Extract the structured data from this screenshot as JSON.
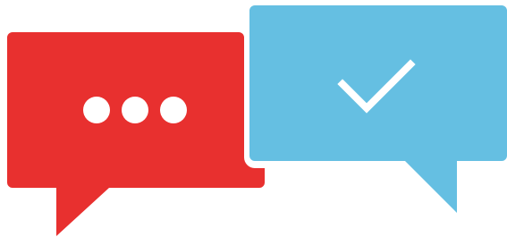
{
  "illustration": {
    "left_bubble": {
      "icon": "ellipsis-icon",
      "color": "#E8302F",
      "icon_color": "#FFFFFF"
    },
    "right_bubble": {
      "icon": "checkmark-icon",
      "color": "#65BFE2",
      "icon_color": "#FFFFFF"
    },
    "background": "#FFFFFF"
  }
}
